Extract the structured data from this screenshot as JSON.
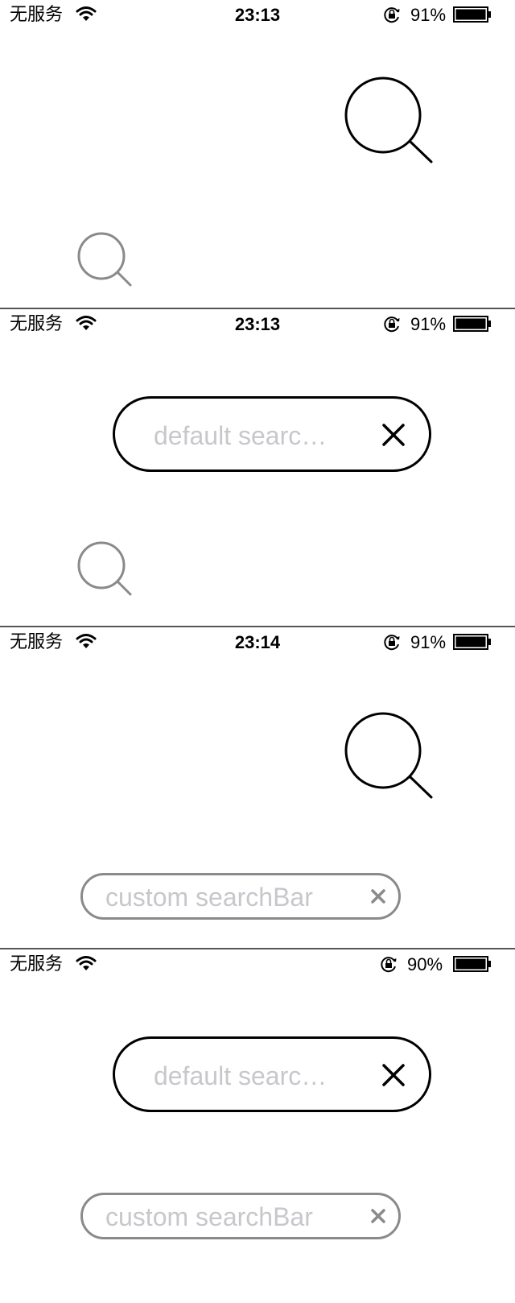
{
  "panels": [
    {
      "status": {
        "carrier": "无服务",
        "time": "23:13",
        "battery": "91%"
      },
      "state": "default-icon + custom-icon"
    },
    {
      "status": {
        "carrier": "无服务",
        "time": "23:13",
        "battery": "91%"
      },
      "default_search": {
        "placeholder": "default searc…"
      }
    },
    {
      "status": {
        "carrier": "无服务",
        "time": "23:14",
        "battery": "91%"
      },
      "custom_search": {
        "placeholder": "custom searchBar"
      }
    },
    {
      "status": {
        "carrier": "无服务",
        "time": "",
        "battery": "90%"
      },
      "default_search": {
        "placeholder": "default searc…"
      },
      "custom_search": {
        "placeholder": "custom searchBar"
      }
    }
  ],
  "icons": {
    "wifi": "wifi-icon",
    "rotation_lock": "rotation-lock-icon",
    "battery": "battery-icon",
    "search": "search-icon",
    "close": "close-icon"
  },
  "colors": {
    "default_bar_border": "#000000",
    "custom_bar_border": "#8a8a8a",
    "placeholder": "#c7c7cc",
    "custom_icon": "#8a8a8a",
    "divider": "#555555"
  }
}
